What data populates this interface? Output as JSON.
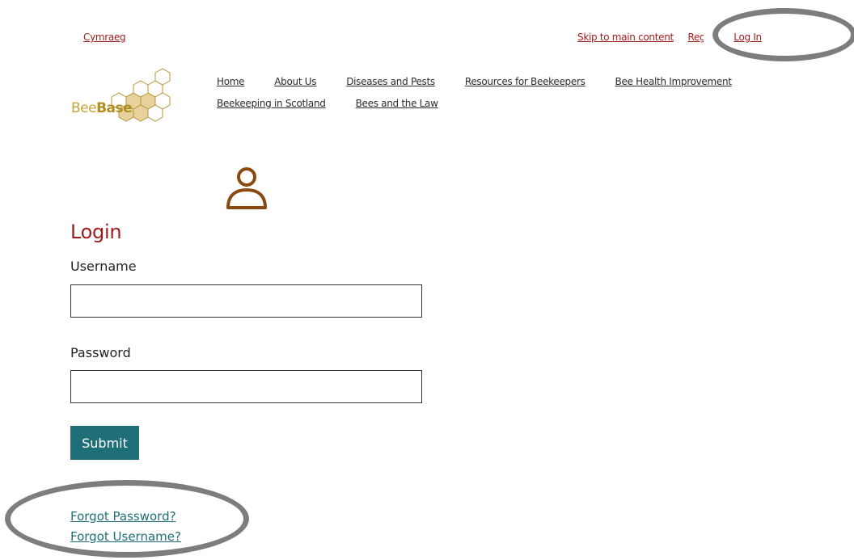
{
  "header": {
    "language_link": "Cymraeg",
    "utility_links": {
      "skip": "Skip to main content",
      "register": "Regist",
      "login": "Log In"
    }
  },
  "logo": {
    "text_light": "Bee",
    "text_bold": "Base"
  },
  "nav": {
    "row1": [
      "Home",
      "About Us",
      "Diseases and Pests",
      "Resources for Beekeepers",
      "Bee Health Improvement"
    ],
    "row2": [
      "Beekeeping in Scotland",
      "Bees and the Law"
    ]
  },
  "form": {
    "title": "Login",
    "username_label": "Username",
    "username_value": "",
    "password_label": "Password",
    "password_value": "",
    "submit_label": "Submit",
    "forgot_password": "Forgot Password?",
    "forgot_username": "Forgot Username?"
  },
  "colors": {
    "accent_red": "#a31c1c",
    "teal": "#1f6f78",
    "user_icon": "#8a4a0f",
    "annotation": "#7d7d7d"
  },
  "icons": [
    "user-icon",
    "honeycomb-logo"
  ]
}
